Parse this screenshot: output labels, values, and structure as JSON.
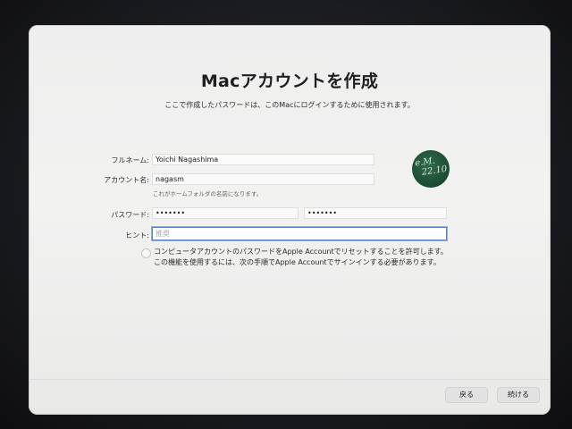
{
  "window": {
    "title": "Macアカウントを作成",
    "subtitle": "ここで作成したパスワードは、このMacにログインするために使用されます。"
  },
  "form": {
    "fullname_label": "フルネーム:",
    "fullname_value": "Yoichi Nagashima",
    "account_label": "アカウント名:",
    "account_value": "nagasm",
    "account_hint": "これがホームフォルダの名前になります。",
    "password_label": "パスワード:",
    "password_value": "•••••••",
    "password_verify_value": "•••••••",
    "hint_label": "ヒント:",
    "hint_placeholder": "推奨",
    "allow_reset_line1": "コンピュータアカウントのパスワードをApple Accountでリセットすることを許可します。",
    "allow_reset_line2": "この機能を使用するには、次の手順でApple Accountでサインインする必要があります。"
  },
  "avatar": {
    "text_line1": "e.M.",
    "text_line2": "22.10"
  },
  "buttons": {
    "back_label": "戻る",
    "continue_label": "続ける"
  },
  "colors": {
    "focus_ring": "#5a7fc0",
    "avatar_green": "#2f6b4a"
  }
}
